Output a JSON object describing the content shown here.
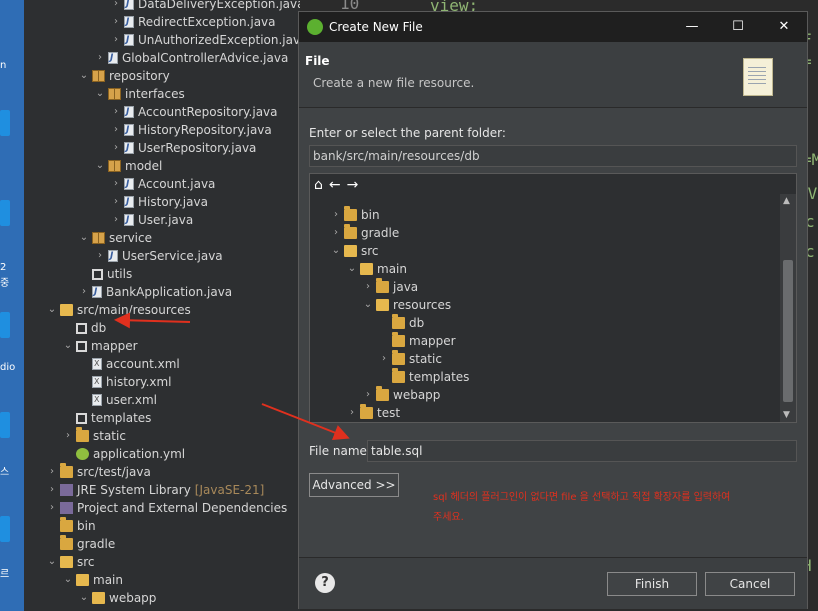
{
  "desktop": {
    "labels": [
      "n",
      "2",
      "중",
      "dio",
      "스",
      "르"
    ]
  },
  "explorer": {
    "rows": [
      {
        "depth": 5,
        "twisty": ">",
        "icon": "jfile",
        "label": "DataDeliveryException.java"
      },
      {
        "depth": 5,
        "twisty": ">",
        "icon": "jfile",
        "label": "RedirectException.java"
      },
      {
        "depth": 5,
        "twisty": ">",
        "icon": "jfile",
        "label": "UnAuthorizedException.java"
      },
      {
        "depth": 4,
        "twisty": ">",
        "icon": "jfile",
        "label": "GlobalControllerAdvice.java"
      },
      {
        "depth": 3,
        "twisty": "v",
        "icon": "pkg",
        "label": "repository"
      },
      {
        "depth": 4,
        "twisty": "v",
        "icon": "pkg",
        "label": "interfaces"
      },
      {
        "depth": 5,
        "twisty": ">",
        "icon": "jfile",
        "label": "AccountRepository.java"
      },
      {
        "depth": 5,
        "twisty": ">",
        "icon": "jfile",
        "label": "HistoryRepository.java"
      },
      {
        "depth": 5,
        "twisty": ">",
        "icon": "jfile",
        "label": "UserRepository.java"
      },
      {
        "depth": 4,
        "twisty": "v",
        "icon": "pkg",
        "label": "model"
      },
      {
        "depth": 5,
        "twisty": ">",
        "icon": "jfile",
        "label": "Account.java"
      },
      {
        "depth": 5,
        "twisty": ">",
        "icon": "jfile",
        "label": "History.java"
      },
      {
        "depth": 5,
        "twisty": ">",
        "icon": "jfile",
        "label": "User.java"
      },
      {
        "depth": 3,
        "twisty": "v",
        "icon": "pkg",
        "label": "service"
      },
      {
        "depth": 4,
        "twisty": ">",
        "icon": "jfile",
        "label": "UserService.java"
      },
      {
        "depth": 3,
        "twisty": "",
        "icon": "grid",
        "label": "utils"
      },
      {
        "depth": 3,
        "twisty": ">",
        "icon": "jfile",
        "label": "BankApplication.java"
      },
      {
        "depth": 1,
        "twisty": "v",
        "icon": "ofolder",
        "label": "src/main/resources"
      },
      {
        "depth": 2,
        "twisty": "",
        "icon": "grid",
        "label": "db"
      },
      {
        "depth": 2,
        "twisty": "v",
        "icon": "grid",
        "label": "mapper"
      },
      {
        "depth": 3,
        "twisty": "",
        "icon": "xml",
        "label": "account.xml"
      },
      {
        "depth": 3,
        "twisty": "",
        "icon": "xml",
        "label": "history.xml"
      },
      {
        "depth": 3,
        "twisty": "",
        "icon": "xml",
        "label": "user.xml"
      },
      {
        "depth": 2,
        "twisty": "",
        "icon": "grid",
        "label": "templates"
      },
      {
        "depth": 2,
        "twisty": ">",
        "icon": "folder",
        "label": "static"
      },
      {
        "depth": 2,
        "twisty": "",
        "icon": "gear",
        "label": "application.yml"
      },
      {
        "depth": 1,
        "twisty": ">",
        "icon": "folder",
        "label": "src/test/java"
      },
      {
        "depth": 1,
        "twisty": ">",
        "icon": "lib",
        "label": "JRE System Library",
        "suffix": "[JavaSE-21]"
      },
      {
        "depth": 1,
        "twisty": ">",
        "icon": "lib",
        "label": "Project and External Dependencies"
      },
      {
        "depth": 1,
        "twisty": "",
        "icon": "folder",
        "label": "bin"
      },
      {
        "depth": 1,
        "twisty": "",
        "icon": "folder",
        "label": "gradle"
      },
      {
        "depth": 1,
        "twisty": "v",
        "icon": "ofolder",
        "label": "src"
      },
      {
        "depth": 2,
        "twisty": "v",
        "icon": "ofolder",
        "label": "main"
      },
      {
        "depth": 3,
        "twisty": "v",
        "icon": "ofolder",
        "label": "webapp"
      }
    ]
  },
  "editor": {
    "snippets": [
      "10",
      "view;",
      "F",
      "=",
      "=M",
      ".V",
      "c",
      "c",
      "H"
    ]
  },
  "dialog": {
    "title": "Create New File",
    "banner_title": "File",
    "banner_subtitle": "Create a new file resource.",
    "parent_label": "Enter or select the parent folder:",
    "parent_value": "bank/src/main/resources/db",
    "folders": [
      {
        "depth": 1,
        "twisty": ">",
        "icon": "folder",
        "label": "bin"
      },
      {
        "depth": 1,
        "twisty": ">",
        "icon": "folder",
        "label": "gradle"
      },
      {
        "depth": 1,
        "twisty": "v",
        "icon": "ofolder",
        "label": "src"
      },
      {
        "depth": 2,
        "twisty": "v",
        "icon": "ofolder",
        "label": "main"
      },
      {
        "depth": 3,
        "twisty": ">",
        "icon": "folder",
        "label": "java"
      },
      {
        "depth": 3,
        "twisty": "v",
        "icon": "ofolder",
        "label": "resources"
      },
      {
        "depth": 4,
        "twisty": "",
        "icon": "folder",
        "label": "db"
      },
      {
        "depth": 4,
        "twisty": "",
        "icon": "folder",
        "label": "mapper"
      },
      {
        "depth": 4,
        "twisty": ">",
        "icon": "folder",
        "label": "static"
      },
      {
        "depth": 4,
        "twisty": "",
        "icon": "folder",
        "label": "templates"
      },
      {
        "depth": 3,
        "twisty": ">",
        "icon": "folder",
        "label": "webapp"
      },
      {
        "depth": 2,
        "twisty": ">",
        "icon": "folder",
        "label": "test"
      }
    ],
    "file_name_label": "File name:",
    "file_name_value": "table.sql",
    "advanced_label": "Advanced >>",
    "note": "sql 헤더의 플러그인이 없다면 file 을 선택하고 직접 확장자를 입력하여주세요.",
    "finish_label": "Finish",
    "cancel_label": "Cancel",
    "help_glyph": "?"
  },
  "colors": {
    "annotation_red": "#e0301e",
    "dialog_bg": "#404345",
    "titlebar_bg": "#1f1f1f"
  }
}
